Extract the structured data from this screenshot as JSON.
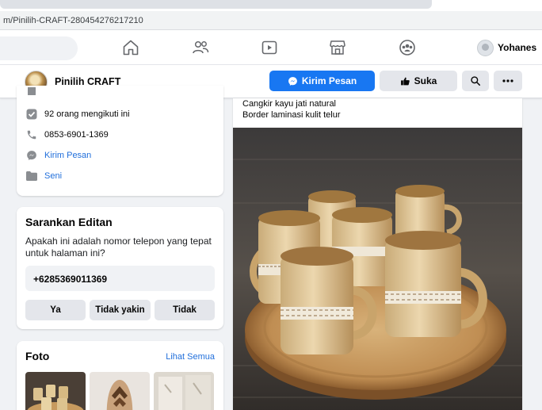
{
  "browser": {
    "url": "m/Pinilih-CRAFT-280454276217210"
  },
  "topnav": {
    "icons": [
      "home-icon",
      "friends-icon",
      "watch-icon",
      "marketplace-icon",
      "groups-icon"
    ],
    "profile_name": "Yohanes"
  },
  "page": {
    "name": "Pinilih CRAFT",
    "message_button": "Kirim Pesan",
    "like_button": "Suka"
  },
  "info": {
    "followers": "92 orang mengikuti ini",
    "phone": "0853-6901-1369",
    "messenger_link": "Kirim Pesan",
    "category": "Seni"
  },
  "suggest": {
    "title": "Sarankan Editan",
    "question": "Apakah ini adalah nomor telepon yang tepat untuk halaman ini?",
    "phone": "+6285369011369",
    "answers": [
      "Ya",
      "Tidak yakin",
      "Tidak"
    ]
  },
  "photos": {
    "title": "Foto",
    "see_all": "Lihat Semua"
  },
  "post": {
    "line1": "Cangkir kayu jati natural",
    "line2": "Border laminasi kulit telur"
  },
  "colors": {
    "accent": "#1877f2",
    "link": "#216fdb",
    "button_gray": "#e4e6eb",
    "background": "#f0f2f5"
  }
}
